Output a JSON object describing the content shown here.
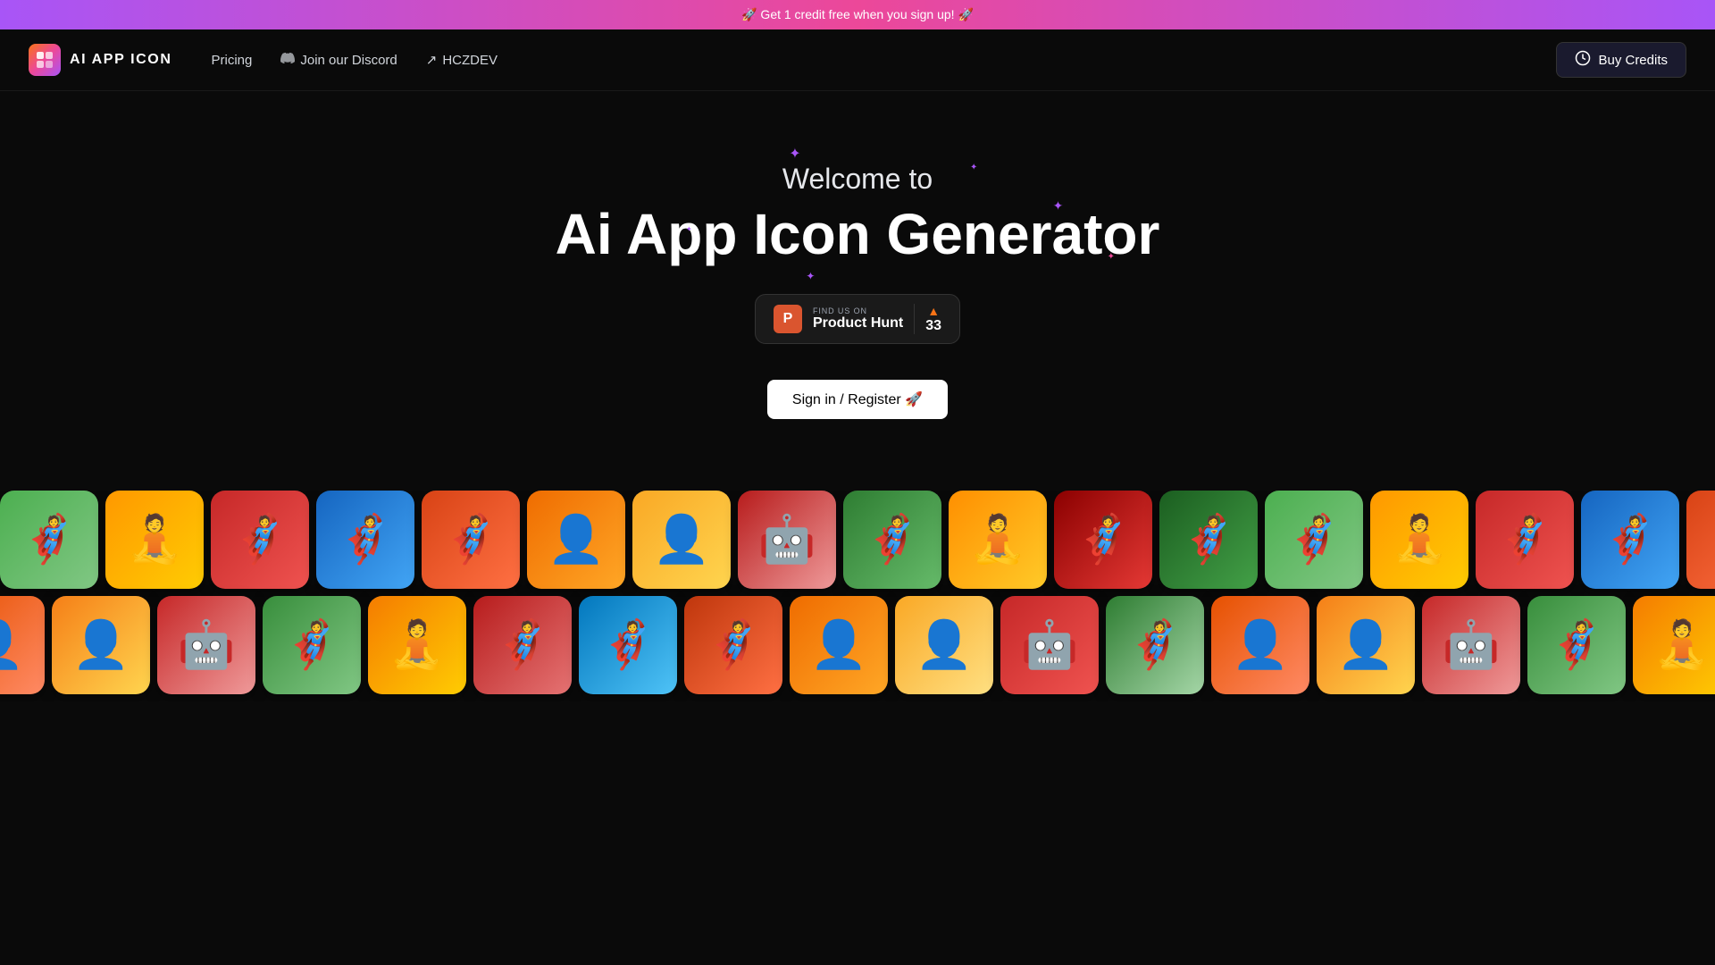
{
  "banner": {
    "text": "🚀 Get 1 credit free when you sign up! 🚀"
  },
  "nav": {
    "logo_text": "AI APP ICON",
    "logo_emoji": "🟧",
    "links": [
      {
        "label": "Pricing",
        "icon": ""
      },
      {
        "label": "Join our Discord",
        "icon": "💬"
      },
      {
        "label": "HCZDEV",
        "icon": "🔗"
      }
    ],
    "buy_credits_label": "Buy Credits",
    "credits_icon": "🎫"
  },
  "hero": {
    "welcome_text": "Welcome to",
    "title_text": "Ai App Icon Generator",
    "product_hunt": {
      "find_text": "FIND US ON",
      "name": "Product Hunt",
      "count": "33",
      "arrow": "▲"
    },
    "signin_label": "Sign in / Register 🚀"
  },
  "icons": {
    "row1": [
      {
        "bg": "bg-green",
        "char": "🦸"
      },
      {
        "bg": "bg-orange",
        "char": "🧘"
      },
      {
        "bg": "bg-red",
        "char": "🦸"
      },
      {
        "bg": "bg-blue-light",
        "char": "🦸"
      },
      {
        "bg": "bg-orange-red",
        "char": "🦸"
      },
      {
        "bg": "bg-orange",
        "char": "👤"
      },
      {
        "bg": "bg-yellow",
        "char": "👤"
      },
      {
        "bg": "bg-red",
        "char": "🤖"
      },
      {
        "bg": "bg-green",
        "char": "🦸"
      },
      {
        "bg": "bg-orange",
        "char": "🧘"
      },
      {
        "bg": "bg-dark-red",
        "char": "🦸"
      },
      {
        "bg": "bg-green",
        "char": "🦸"
      }
    ],
    "row2": [
      {
        "bg": "bg-orange",
        "char": "👤"
      },
      {
        "bg": "bg-yellow",
        "char": "👤"
      },
      {
        "bg": "bg-red",
        "char": "🤖"
      },
      {
        "bg": "bg-green",
        "char": "🦸"
      },
      {
        "bg": "bg-orange",
        "char": "🧘"
      },
      {
        "bg": "bg-red",
        "char": "🦸"
      },
      {
        "bg": "bg-blue-light",
        "char": "🦸"
      },
      {
        "bg": "bg-orange-red",
        "char": "🦸"
      },
      {
        "bg": "bg-orange",
        "char": "👤"
      },
      {
        "bg": "bg-yellow",
        "char": "👤"
      },
      {
        "bg": "bg-red",
        "char": "🤖"
      },
      {
        "bg": "bg-green",
        "char": "🦸"
      }
    ]
  }
}
